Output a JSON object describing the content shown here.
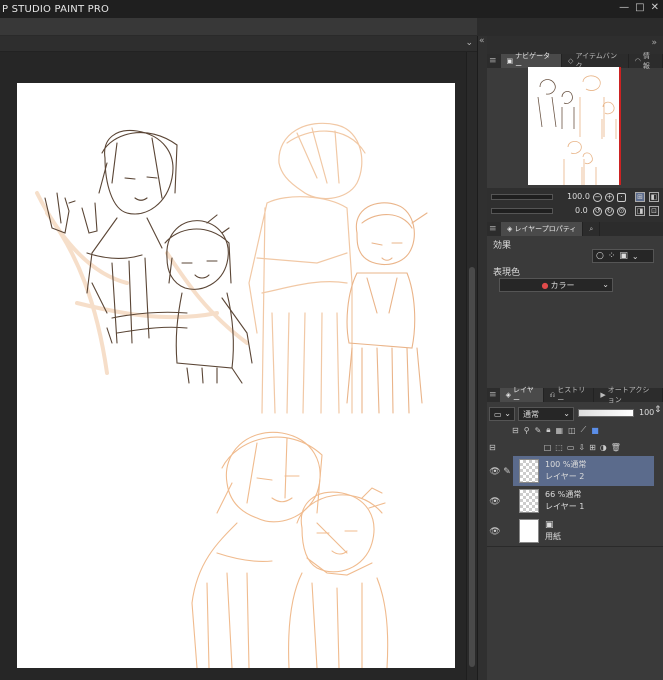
{
  "window": {
    "title": "P STUDIO PAINT PRO",
    "controls": [
      "—",
      "□",
      "✕"
    ]
  },
  "navigator": {
    "tabs": [
      {
        "label": "ナビゲーター",
        "icon": "navigator-icon"
      },
      {
        "label": "アイテムバンク",
        "icon": "item-bank-icon"
      },
      {
        "label": "情報",
        "icon": "info-icon"
      }
    ],
    "zoom": "100.0",
    "rotation": "0.0"
  },
  "layer_property": {
    "tabs": [
      {
        "label": "レイヤープロパティ"
      },
      {
        "label": ""
      }
    ],
    "effect_label": "効果",
    "color_label": "表現色",
    "color_value": "カラー"
  },
  "layers_panel": {
    "tabs": [
      {
        "label": "レイヤー"
      },
      {
        "label": "ヒストリー"
      },
      {
        "label": "オートアクション"
      }
    ],
    "blend_mode": "通常",
    "opacity": "100",
    "layers": [
      {
        "line1": "100 %通常",
        "line2": "レイヤー 2",
        "selected": true,
        "thumb": "transparent"
      },
      {
        "line1": "66 %通常",
        "line2": "レイヤー 1",
        "selected": false,
        "thumb": "transparent"
      },
      {
        "line1": "",
        "line2": "用紙",
        "selected": false,
        "thumb": "paper"
      }
    ]
  },
  "colors": {
    "accent": "#5b6b8c",
    "sketch": "#e8b487",
    "lineart": "#5a4535"
  }
}
